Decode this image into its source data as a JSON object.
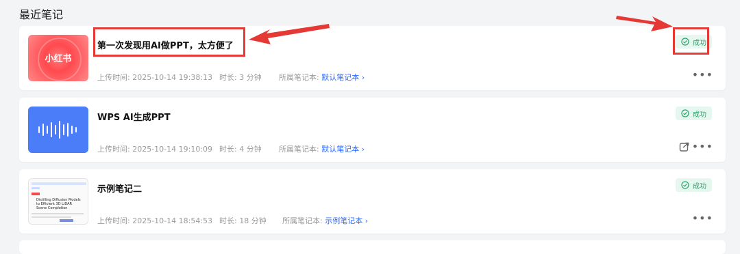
{
  "section_title": "最近笔记",
  "notes": [
    {
      "thumb_label": "小红书",
      "title": "第一次发现用AI做PPT，太方便了",
      "upload_label": "上传时间: ",
      "upload_time": "2025-10-14 19:38:13",
      "duration_label": "时长: ",
      "duration": "3 分钟",
      "notebook_label": "所属笔记本: ",
      "notebook": "默认笔记本",
      "status": "成功"
    },
    {
      "title": "WPS AI生成PPT",
      "upload_label": "上传时间: ",
      "upload_time": "2025-10-14 19:10:09",
      "duration_label": "时长: ",
      "duration": "4 分钟",
      "notebook_label": "所属笔记本: ",
      "notebook": "默认笔记本",
      "status": "成功"
    },
    {
      "thumb_doc_title": "Distilling Diffusion Models to Efficient 3D LiDAR Scene Completion",
      "title": "示例笔记二",
      "upload_label": "上传时间: ",
      "upload_time": "2025-10-14 18:54:53",
      "duration_label": "时长: ",
      "duration": "18 分钟",
      "notebook_label": "所属笔记本: ",
      "notebook": "示例笔记本",
      "status": "成功"
    }
  ],
  "colors": {
    "accent": "#2f6bff",
    "success_bg": "#e6f7ef",
    "success_text": "#2ba36a",
    "annotation": "#e53935"
  },
  "icons": {
    "status": "check-circle-icon",
    "more": "more-horizontal-icon",
    "share": "share-icon",
    "chevron": "chevron-right-icon"
  }
}
